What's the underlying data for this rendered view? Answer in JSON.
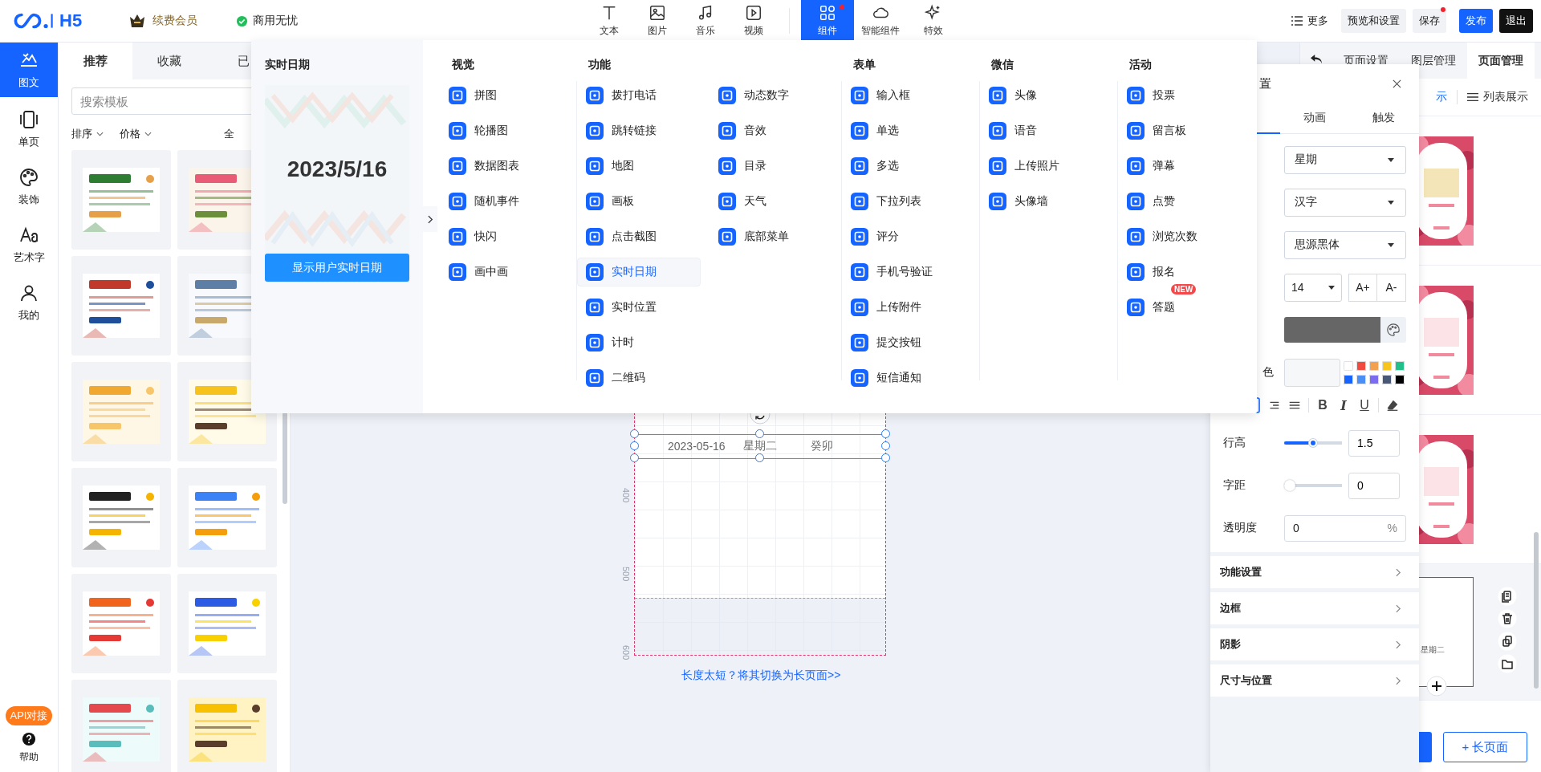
{
  "topbar": {
    "logo": "H5",
    "vip": "续费会员",
    "commercial": "商用无忧",
    "tools": [
      {
        "label": "文本",
        "selected": false,
        "dot": false
      },
      {
        "label": "图片",
        "selected": false,
        "dot": false
      },
      {
        "label": "音乐",
        "selected": false,
        "dot": false
      },
      {
        "label": "视频",
        "selected": false,
        "dot": false
      },
      {
        "label": "组件",
        "selected": true,
        "dot": true
      },
      {
        "label": "智能组件",
        "selected": false,
        "dot": false
      },
      {
        "label": "特效",
        "selected": false,
        "dot": false
      }
    ],
    "actions": [
      {
        "label": "更多",
        "kind": "menu",
        "dot": false
      },
      {
        "label": "预览和设置",
        "kind": "plain",
        "dot": false
      },
      {
        "label": "保存",
        "kind": "plain",
        "dot": true
      },
      {
        "label": "发布",
        "kind": "primary",
        "dot": false
      },
      {
        "label": "退出",
        "kind": "dark",
        "dot": false
      }
    ]
  },
  "nav": {
    "items": [
      {
        "label": "图文",
        "selected": true
      },
      {
        "label": "单页",
        "selected": false
      },
      {
        "label": "装饰",
        "selected": false
      },
      {
        "label": "艺术字",
        "selected": false
      },
      {
        "label": "我的",
        "selected": false
      }
    ],
    "api_badge": "API对接",
    "help": "帮助"
  },
  "templates": {
    "tabs": [
      {
        "label": "推荐",
        "selected": true
      },
      {
        "label": "收藏",
        "selected": false
      },
      {
        "label": "已",
        "selected": false
      }
    ],
    "search": {
      "placeholder": "搜索模板"
    },
    "filters": [
      {
        "label": "排序",
        "kind": "dropdown"
      },
      {
        "label": "价格",
        "kind": "dropdown"
      },
      {
        "label": "全",
        "kind": "plain"
      }
    ],
    "cards": [
      {
        "kind": "picture"
      },
      {
        "kind": "picture"
      },
      {
        "kind": "picture"
      },
      {
        "kind": "picture"
      },
      {
        "kind": "picture"
      },
      {
        "kind": "picture"
      },
      {
        "kind": "picture"
      },
      {
        "kind": "picture"
      },
      {
        "kind": "picture"
      },
      {
        "kind": "picture"
      },
      {
        "kind": "picture"
      },
      {
        "kind": "picture"
      }
    ]
  },
  "canvas": {
    "ruler": [
      "400",
      "500",
      "600"
    ],
    "element_texts": [
      "2023-05-16",
      "星期二",
      "癸卯"
    ],
    "long_page_link": "长度太短？将其切换为长页面>>"
  },
  "component_menu": {
    "preview": {
      "title": "实时日期",
      "date": "2023/5/16",
      "button": "显示用户实时日期"
    },
    "groups": [
      {
        "title": "视觉",
        "columns": [
          [
            {
              "label": "拼图",
              "selected": false
            },
            {
              "label": "轮播图",
              "selected": false
            },
            {
              "label": "数据图表",
              "selected": false
            },
            {
              "label": "随机事件",
              "selected": false
            },
            {
              "label": "快闪",
              "selected": false
            },
            {
              "label": "画中画",
              "selected": false
            }
          ]
        ]
      },
      {
        "title": "功能",
        "columns": [
          [
            {
              "label": "拨打电话",
              "selected": false
            },
            {
              "label": "跳转链接",
              "selected": false
            },
            {
              "label": "地图",
              "selected": false
            },
            {
              "label": "画板",
              "selected": false
            },
            {
              "label": "点击截图",
              "selected": false
            },
            {
              "label": "实时日期",
              "selected": true
            },
            {
              "label": "实时位置",
              "selected": false
            },
            {
              "label": "计时",
              "selected": false
            },
            {
              "label": "二维码",
              "selected": false
            }
          ],
          [
            {
              "label": "动态数字",
              "selected": false
            },
            {
              "label": "音效",
              "selected": false
            },
            {
              "label": "目录",
              "selected": false
            },
            {
              "label": "天气",
              "selected": false
            },
            {
              "label": "底部菜单",
              "selected": false
            }
          ]
        ]
      },
      {
        "title": "表单",
        "columns": [
          [
            {
              "label": "输入框",
              "selected": false
            },
            {
              "label": "单选",
              "selected": false
            },
            {
              "label": "多选",
              "selected": false
            },
            {
              "label": "下拉列表",
              "selected": false
            },
            {
              "label": "评分",
              "selected": false
            },
            {
              "label": "手机号验证",
              "selected": false
            },
            {
              "label": "上传附件",
              "selected": false
            },
            {
              "label": "提交按钮",
              "selected": false
            },
            {
              "label": "短信通知",
              "selected": false
            }
          ]
        ]
      },
      {
        "title": "微信",
        "columns": [
          [
            {
              "label": "头像",
              "selected": false
            },
            {
              "label": "语音",
              "selected": false
            },
            {
              "label": "上传照片",
              "selected": false
            },
            {
              "label": "头像墙",
              "selected": false
            }
          ]
        ]
      },
      {
        "title": "活动",
        "columns": [
          [
            {
              "label": "投票",
              "selected": false
            },
            {
              "label": "留言板",
              "selected": false
            },
            {
              "label": "弹幕",
              "selected": false
            },
            {
              "label": "点赞",
              "selected": false
            },
            {
              "label": "浏览次数",
              "selected": false
            },
            {
              "label": "报名",
              "selected": false
            },
            {
              "label": "答题",
              "selected": false,
              "badge": "NEW"
            }
          ]
        ]
      }
    ]
  },
  "properties": {
    "title": "置",
    "tabs": [
      {
        "label": "动画",
        "selected": false
      },
      {
        "label": "触发",
        "selected": false
      }
    ],
    "selects": [
      "星期",
      "汉字",
      "思源黑体"
    ],
    "font_size": "14",
    "size_buttons": [
      "A+",
      "A-"
    ],
    "color_label": "色",
    "swatches": [
      {
        "color": "#ffffff"
      },
      {
        "color": "#f04b3e"
      },
      {
        "color": "#f2a24f"
      },
      {
        "color": "#f8c41e"
      },
      {
        "color": "#21c08b"
      },
      {
        "color": "#1564ff"
      },
      {
        "color": "#4a8ff5"
      },
      {
        "color": "#7b6cf0"
      },
      {
        "color": "#4a5878"
      },
      {
        "color": "#000000"
      }
    ],
    "format_buttons": [
      "B",
      "I",
      "U"
    ],
    "sliders": [
      {
        "label": "行高",
        "level": 0.5,
        "value": "1.5"
      },
      {
        "label": "字距",
        "level": 0,
        "value": "0"
      }
    ],
    "opacity": {
      "label": "透明度",
      "value": "0",
      "unit": "%"
    },
    "sections": [
      "功能设置",
      "边框",
      "阴影",
      "尺寸与位置"
    ]
  },
  "pages_panel": {
    "tabs": [
      {
        "label": "页面设置",
        "selected": false
      },
      {
        "label": "图层管理",
        "selected": false
      },
      {
        "label": "页面管理",
        "selected": true
      }
    ],
    "views": [
      {
        "label": "示",
        "selected": true
      },
      {
        "label": "列表展示",
        "selected": false
      }
    ],
    "pages": [
      {
        "kind": "picture",
        "selected": false
      },
      {
        "kind": "picture",
        "selected": false
      },
      {
        "kind": "picture",
        "selected": false
      },
      {
        "kind": "blank",
        "caption": "星期二",
        "selected": true
      }
    ],
    "long_page_button": "+ 长页面"
  }
}
